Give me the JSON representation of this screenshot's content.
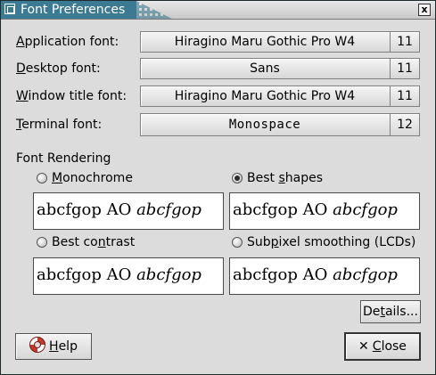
{
  "window": {
    "title": "Font Preferences",
    "close_glyph": "x"
  },
  "fonts": [
    {
      "label_pre": "",
      "label_key": "A",
      "label_post": "pplication font:",
      "font": "Hiragino Maru Gothic Pro W4",
      "size": "11",
      "mono": false
    },
    {
      "label_pre": "",
      "label_key": "D",
      "label_post": "esktop font:",
      "font": "Sans",
      "size": "11",
      "mono": false
    },
    {
      "label_pre": "",
      "label_key": "W",
      "label_post": "indow title font:",
      "font": "Hiragino Maru Gothic Pro W4",
      "size": "11",
      "mono": false
    },
    {
      "label_pre": "",
      "label_key": "T",
      "label_post": "erminal font:",
      "font": "Monospace",
      "size": "12",
      "mono": true
    }
  ],
  "rendering": {
    "heading": "Font Rendering",
    "options": [
      {
        "pre": "",
        "key": "M",
        "post": "onochrome",
        "checked": false
      },
      {
        "pre": "Best ",
        "key": "s",
        "post": "hapes",
        "checked": true
      },
      {
        "pre": "Best co",
        "key": "n",
        "post": "trast",
        "checked": false
      },
      {
        "pre": "Sub",
        "key": "p",
        "post": "ixel smoothing (LCDs)",
        "checked": false
      }
    ],
    "preview_regular": "abcfgop AO ",
    "preview_italic": "abcfgop"
  },
  "buttons": {
    "details_pre": "De",
    "details_key": "t",
    "details_post": "ails...",
    "help_pre": "",
    "help_key": "H",
    "help_post": "elp",
    "help_icon": "lifebuoy-icon",
    "close_pre": "",
    "close_key": "C",
    "close_post": "lose",
    "close_icon": "x-icon",
    "close_glyph": "✕"
  }
}
